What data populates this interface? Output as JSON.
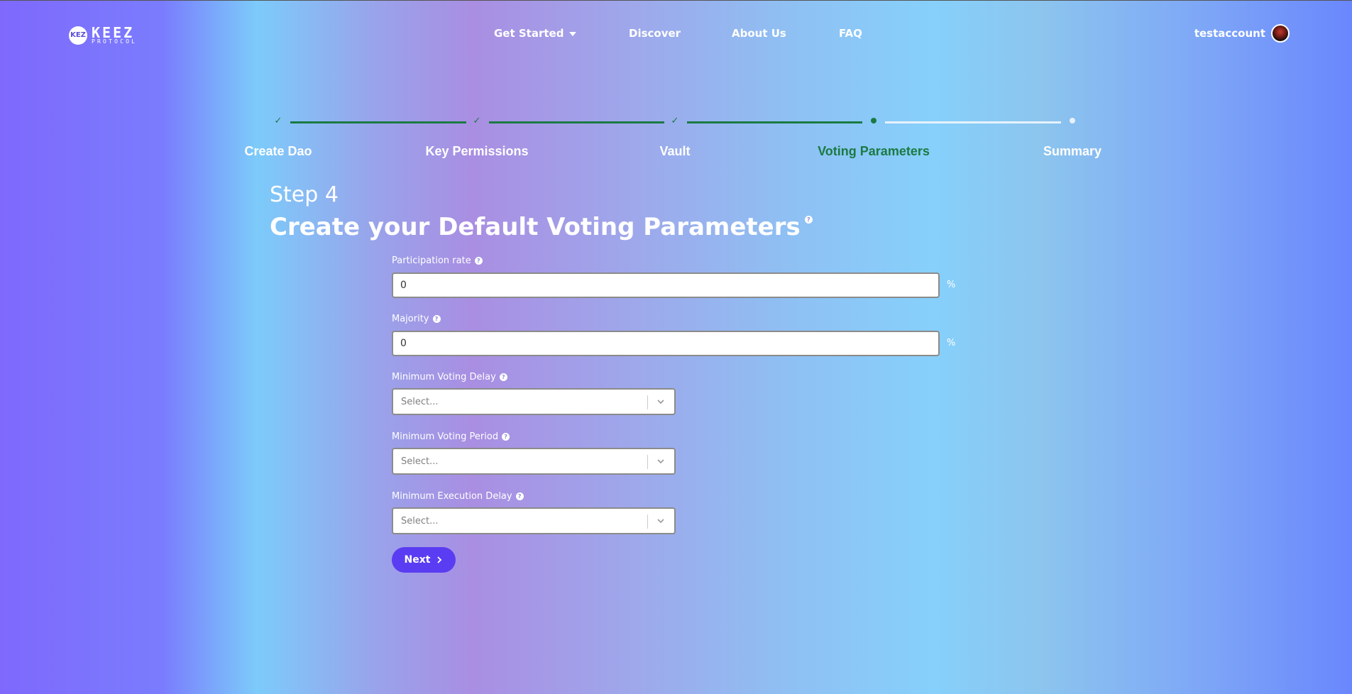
{
  "header": {
    "logo": {
      "mark": "KEZ",
      "wordmark": "KEEZ",
      "subtitle": "PROTOCOL"
    },
    "nav": [
      {
        "label": "Get Started",
        "has_dropdown": true
      },
      {
        "label": "Discover"
      },
      {
        "label": "About Us"
      },
      {
        "label": "FAQ"
      }
    ],
    "user": {
      "name": "testaccount"
    }
  },
  "stepper": {
    "steps": [
      {
        "label": "Create Dao",
        "status": "complete"
      },
      {
        "label": "Key Permissions",
        "status": "complete"
      },
      {
        "label": "Vault",
        "status": "complete"
      },
      {
        "label": "Voting Parameters",
        "status": "active"
      },
      {
        "label": "Summary",
        "status": "pending"
      }
    ],
    "check_glyph": "✓"
  },
  "main": {
    "step_number": "Step 4",
    "title": "Create your Default Voting Parameters",
    "help_glyph": "?",
    "fields": [
      {
        "label": "Participation rate",
        "value": "0",
        "unit": "%"
      },
      {
        "label": "Majority",
        "value": "0",
        "unit": "%"
      },
      {
        "label": "Minimum Voting Delay",
        "placeholder": "Select..."
      },
      {
        "label": "Minimum Voting Period",
        "placeholder": "Select..."
      },
      {
        "label": "Minimum Execution Delay",
        "placeholder": "Select..."
      }
    ],
    "next_label": "Next"
  },
  "colors": {
    "active_step": "#1b7a43",
    "pending_line": "#e6f2fb",
    "button": "#5a3df2"
  }
}
